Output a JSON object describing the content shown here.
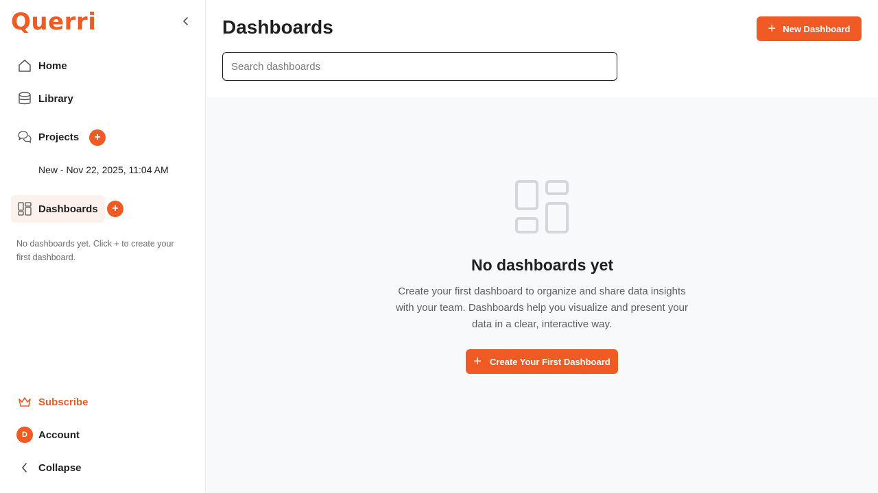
{
  "brand": {
    "name": "Querri",
    "color": "#f05a24"
  },
  "sidebar": {
    "nav": {
      "home": {
        "label": "Home",
        "icon": "home-icon"
      },
      "library": {
        "label": "Library",
        "icon": "database-icon"
      },
      "projects": {
        "label": "Projects",
        "icon": "chat-bubbles-icon",
        "add": "+"
      },
      "dashboards": {
        "label": "Dashboards",
        "icon": "dashboard-icon",
        "add": "+"
      }
    },
    "project_items": [
      "New - Nov 22, 2025, 11:04 AM"
    ],
    "dashboards_empty_hint": "No dashboards yet. Click + to create your first dashboard.",
    "footer": {
      "subscribe": {
        "label": "Subscribe",
        "icon": "basket-icon"
      },
      "account": {
        "label": "Account",
        "avatar_initial": "D"
      },
      "collapse": {
        "label": "Collapse",
        "icon": "chevron-left-icon"
      }
    }
  },
  "header": {
    "title": "Dashboards",
    "new_button": "New Dashboard",
    "search_placeholder": "Search dashboards",
    "search_value": ""
  },
  "empty_state": {
    "title": "No dashboards yet",
    "description": "Create your first dashboard to organize and share data insights with your team. Dashboards help you visualize and present your data in a clear, interactive way.",
    "cta": "Create Your First Dashboard"
  }
}
